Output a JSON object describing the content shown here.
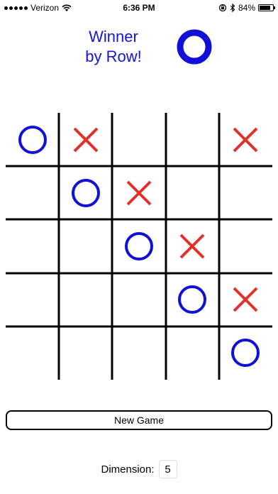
{
  "status_bar": {
    "carrier": "Verizon",
    "time": "6:36 PM",
    "battery": "84%",
    "battery_level": 0.84
  },
  "header": {
    "winner_line1": "Winner",
    "winner_line2": "by Row!",
    "winner_symbol": "O"
  },
  "colors": {
    "o_color": "#1010d8",
    "x_color": "#e0322b",
    "grid_color": "#000000",
    "winner_text": "#1515d6"
  },
  "board": {
    "dimension": 5,
    "cells": [
      [
        "O",
        "X",
        "",
        "",
        "X"
      ],
      [
        "",
        "O",
        "X",
        "",
        ""
      ],
      [
        "",
        "",
        "O",
        "X",
        ""
      ],
      [
        "",
        "",
        "",
        "O",
        "X"
      ],
      [
        "",
        "",
        "",
        "",
        "O"
      ]
    ]
  },
  "controls": {
    "new_game_label": "New Game",
    "dimension_label": "Dimension:",
    "dimension_value": "5"
  }
}
